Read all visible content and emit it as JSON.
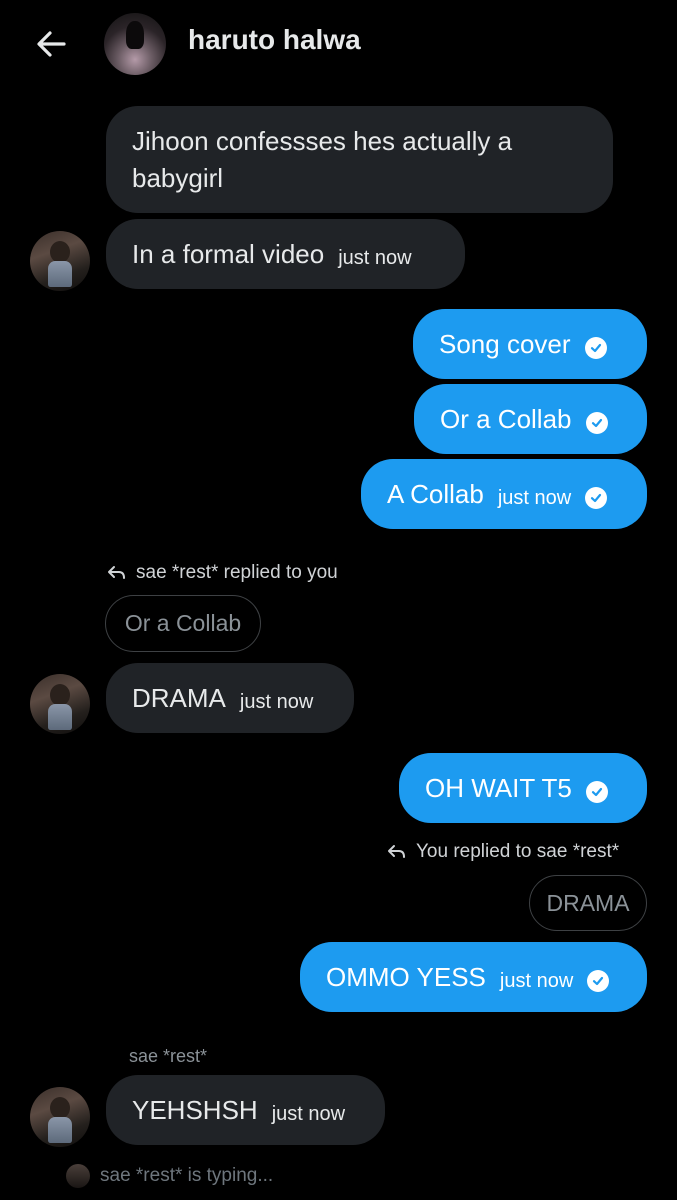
{
  "header": {
    "name": "haruto halwa",
    "back_icon": "arrow-left-icon"
  },
  "messages": {
    "m1": {
      "text": "Jihoon confessses hes actually a babygirl"
    },
    "m2": {
      "text": "In a formal video",
      "time": "just now"
    },
    "m3": {
      "text": "Song cover"
    },
    "m4": {
      "text": "Or a Collab"
    },
    "m5": {
      "text": "A Collab",
      "time": "just now"
    },
    "r1": {
      "label": "sae *rest* replied to you",
      "quote": "Or a Collab"
    },
    "m6": {
      "text": "DRAMA",
      "time": "just now"
    },
    "m7": {
      "text": "OH WAIT T5"
    },
    "r2": {
      "label": "You replied to sae *rest*",
      "quote": "DRAMA"
    },
    "m8": {
      "text": "OMMO YESS",
      "time": "just now"
    },
    "sender": "sae *rest*",
    "m9": {
      "text": "YEHSHSH",
      "time": "just now"
    }
  },
  "typing": "sae *rest* is typing...",
  "colors": {
    "background": "#000000",
    "incoming": "#202327",
    "outgoing": "#1d9bf0",
    "text": "#e7e9ea"
  }
}
